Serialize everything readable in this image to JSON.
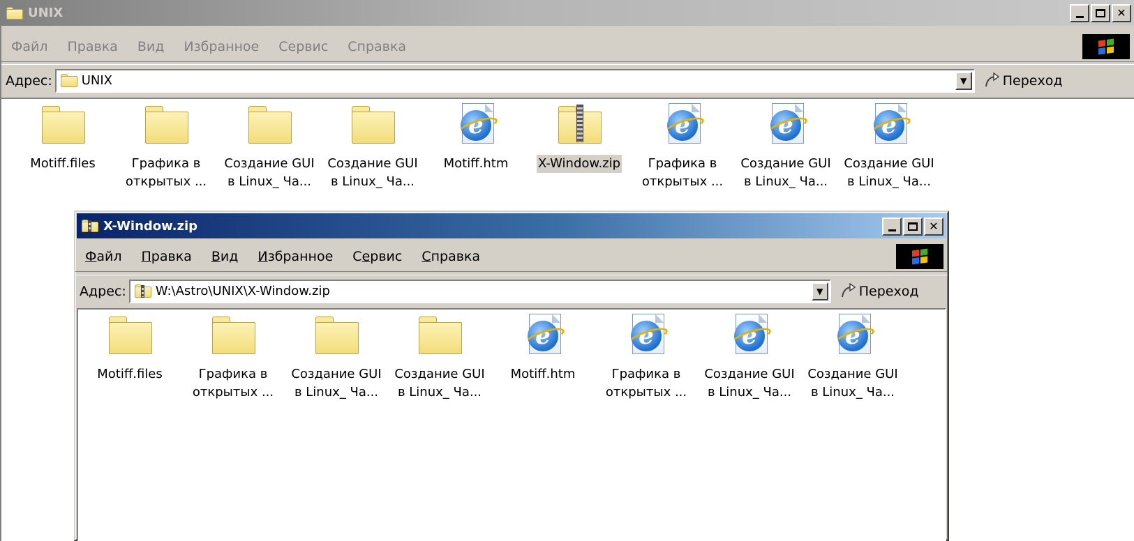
{
  "outer_window": {
    "title": "UNIX",
    "menu": [
      "Файл",
      "Правка",
      "Вид",
      "Избранное",
      "Сервис",
      "Справка"
    ],
    "address_label": "Адрес:",
    "address_value": "UNIX",
    "go_label": "Переход",
    "items": [
      {
        "label_line1": "Motiff.files",
        "label_line2": "",
        "icon": "folder-icon"
      },
      {
        "label_line1": "Графика в",
        "label_line2": "открытых ...",
        "icon": "folder-icon"
      },
      {
        "label_line1": "Создание GUI",
        "label_line2": "в Linux_ Ча...",
        "icon": "folder-icon"
      },
      {
        "label_line1": "Создание GUI",
        "label_line2": "в Linux_ Ча...",
        "icon": "folder-icon"
      },
      {
        "label_line1": "Motiff.htm",
        "label_line2": "",
        "icon": "ie-document-icon"
      },
      {
        "label_line1": "X-Window.zip",
        "label_line2": "",
        "icon": "zip-folder-icon"
      },
      {
        "label_line1": "Графика в",
        "label_line2": "открытых ...",
        "icon": "ie-document-icon"
      },
      {
        "label_line1": "Создание GUI",
        "label_line2": "в Linux_ Ча...",
        "icon": "ie-document-icon"
      },
      {
        "label_line1": "Создание GUI",
        "label_line2": "в Linux_ Ча...",
        "icon": "ie-document-icon"
      }
    ]
  },
  "inner_window": {
    "title": "X-Window.zip",
    "menu": [
      {
        "pre": "",
        "u": "Ф",
        "post": "айл"
      },
      {
        "pre": "",
        "u": "П",
        "post": "равка"
      },
      {
        "pre": "",
        "u": "В",
        "post": "ид"
      },
      {
        "pre": "",
        "u": "И",
        "post": "збранное"
      },
      {
        "pre": "С",
        "u": "е",
        "post": "рвис"
      },
      {
        "pre": "",
        "u": "С",
        "post": "правка"
      }
    ],
    "address_label": "Адрес:",
    "address_value": "W:\\Astro\\UNIX\\X-Window.zip",
    "go_label": "Переход",
    "items": [
      {
        "label_line1": "Motiff.files",
        "label_line2": "",
        "icon": "folder-icon"
      },
      {
        "label_line1": "Графика в",
        "label_line2": "открытых ...",
        "icon": "folder-icon"
      },
      {
        "label_line1": "Создание GUI",
        "label_line2": "в Linux_ Ча...",
        "icon": "folder-icon"
      },
      {
        "label_line1": "Создание GUI",
        "label_line2": "в Linux_ Ча...",
        "icon": "folder-icon"
      },
      {
        "label_line1": "Motiff.htm",
        "label_line2": "",
        "icon": "ie-document-icon"
      },
      {
        "label_line1": "Графика в",
        "label_line2": "открытых ...",
        "icon": "ie-document-icon"
      },
      {
        "label_line1": "Создание GUI",
        "label_line2": "в Linux_ Ча...",
        "icon": "ie-document-icon"
      },
      {
        "label_line1": "Создание GUI",
        "label_line2": "в Linux_ Ча...",
        "icon": "ie-document-icon"
      }
    ]
  },
  "colors": {
    "window_face": "#d4d0c8",
    "active_title_start": "#0a246a",
    "active_title_end": "#a6caf0",
    "inactive_title": "#808080"
  }
}
